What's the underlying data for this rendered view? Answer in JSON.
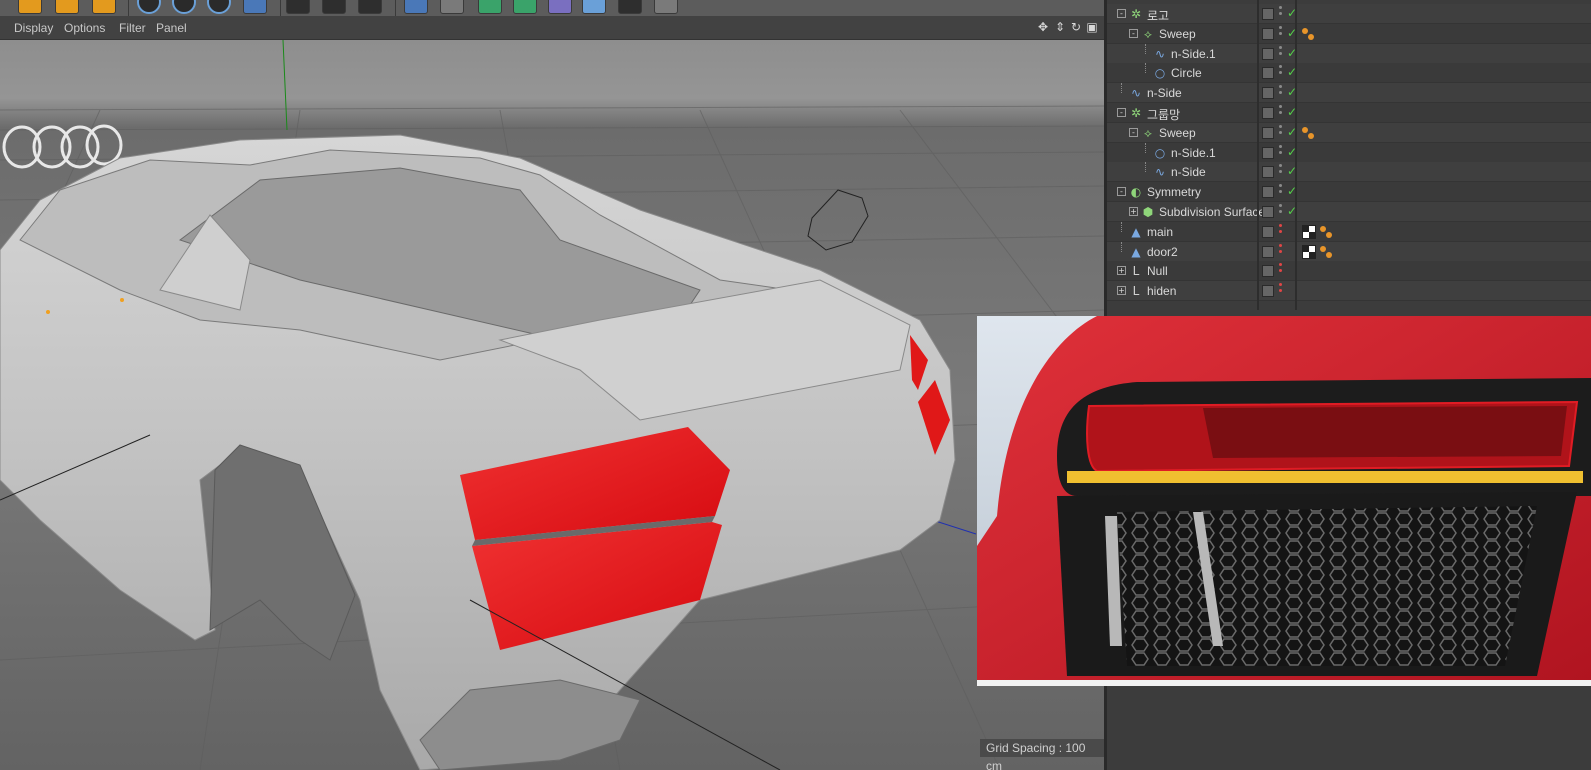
{
  "viewport": {
    "menu": [
      "Display",
      "Options",
      "Filter",
      "Panel"
    ],
    "grid_spacing_label": "Grid Spacing : 100 cm"
  },
  "object_manager": {
    "objects": [
      {
        "name": "로고",
        "icon": "symmetry-icon",
        "expander": "-",
        "level": 0,
        "color": "#8fd67a",
        "check": true
      },
      {
        "name": "Sweep",
        "icon": "sweep-icon",
        "expander": "-",
        "level": 1,
        "color": "#8fd67a",
        "check": true,
        "tags": [
          "phong-tag"
        ]
      },
      {
        "name": "n-Side.1",
        "icon": "spline-icon",
        "expander": "",
        "level": 2,
        "color": "#7aa8e0",
        "check": true
      },
      {
        "name": "Circle",
        "icon": "circle-spline-icon",
        "expander": "",
        "level": 2,
        "color": "#7aa8e0",
        "check": true
      },
      {
        "name": "n-Side",
        "icon": "spline-icon",
        "expander": "",
        "level": 0,
        "color": "#7aa8e0",
        "check": true
      },
      {
        "name": "그룹망",
        "icon": "symmetry-icon",
        "expander": "-",
        "level": 0,
        "color": "#8fd67a",
        "check": true
      },
      {
        "name": "Sweep",
        "icon": "sweep-icon",
        "expander": "-",
        "level": 1,
        "color": "#8fd67a",
        "check": true,
        "tags": [
          "phong-tag"
        ]
      },
      {
        "name": "n-Side.1",
        "icon": "circle-spline-icon",
        "expander": "",
        "level": 2,
        "color": "#7aa8e0",
        "check": true
      },
      {
        "name": "n-Side",
        "icon": "spline-icon",
        "expander": "",
        "level": 2,
        "color": "#7aa8e0",
        "check": true
      },
      {
        "name": "Symmetry",
        "icon": "symmetry-green-icon",
        "expander": "-",
        "level": 0,
        "color": "#8fd67a",
        "check": true
      },
      {
        "name": "Subdivision Surface",
        "icon": "subdivision-surface-icon",
        "expander": "+",
        "level": 1,
        "color": "#8fd67a",
        "check": true
      },
      {
        "name": "main",
        "icon": "polygon-object-icon",
        "expander": "",
        "level": 0,
        "color": "#7aa8e0",
        "check": false,
        "tags": [
          "material-tag",
          "phong-tag"
        ]
      },
      {
        "name": "door2",
        "icon": "polygon-object-icon",
        "expander": "",
        "level": 0,
        "color": "#7aa8e0",
        "check": false,
        "tags": [
          "material-tag",
          "phong-tag"
        ]
      },
      {
        "name": "Null",
        "icon": "null-object-icon",
        "expander": "+",
        "level": 0,
        "color": "#d0d0d0",
        "check": false
      },
      {
        "name": "hiden",
        "icon": "null-object-icon",
        "expander": "+",
        "level": 0,
        "color": "#d0d0d0",
        "check": false
      }
    ]
  },
  "colors": {
    "accent_red": "#e8141c",
    "check_green": "#55d04a",
    "x_axis": "#c02020",
    "y_axis": "#1a8a1a",
    "z_axis": "#2030b0"
  }
}
